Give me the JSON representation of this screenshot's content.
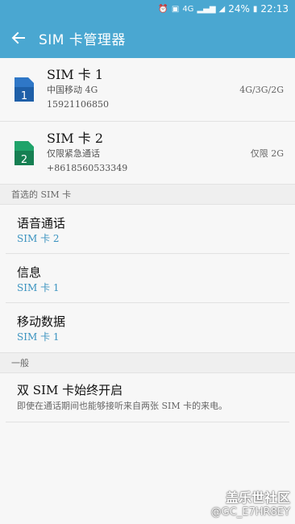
{
  "status_bar": {
    "battery": "24%",
    "time": "22:13",
    "network": "4G"
  },
  "app_bar": {
    "title": "SIM 卡管理器"
  },
  "sims": [
    {
      "name": "SIM 卡 1",
      "carrier": "中国移动 4G",
      "number": "15921106850",
      "network": "4G/3G/2G",
      "color": "#2f77c7",
      "badge": "1"
    },
    {
      "name": "SIM 卡 2",
      "carrier": "仅限紧急通话",
      "number": "+8618560533349",
      "network": "仅限 2G",
      "color": "#1fa36a",
      "badge": "2"
    }
  ],
  "preferred": {
    "header": "首选的 SIM 卡",
    "items": [
      {
        "title": "语音通话",
        "value": "SIM 卡 2"
      },
      {
        "title": "信息",
        "value": "SIM 卡 1"
      },
      {
        "title": "移动数据",
        "value": "SIM 卡 1"
      }
    ]
  },
  "general": {
    "header": "一般",
    "dual_sim_title": "双 SIM 卡始终开启",
    "dual_sim_desc": "即使在通话期间也能够接听来自两张 SIM 卡的来电。"
  },
  "watermark": {
    "line1": "盖乐世社区",
    "line2": "@GC_E7HR8EY"
  }
}
